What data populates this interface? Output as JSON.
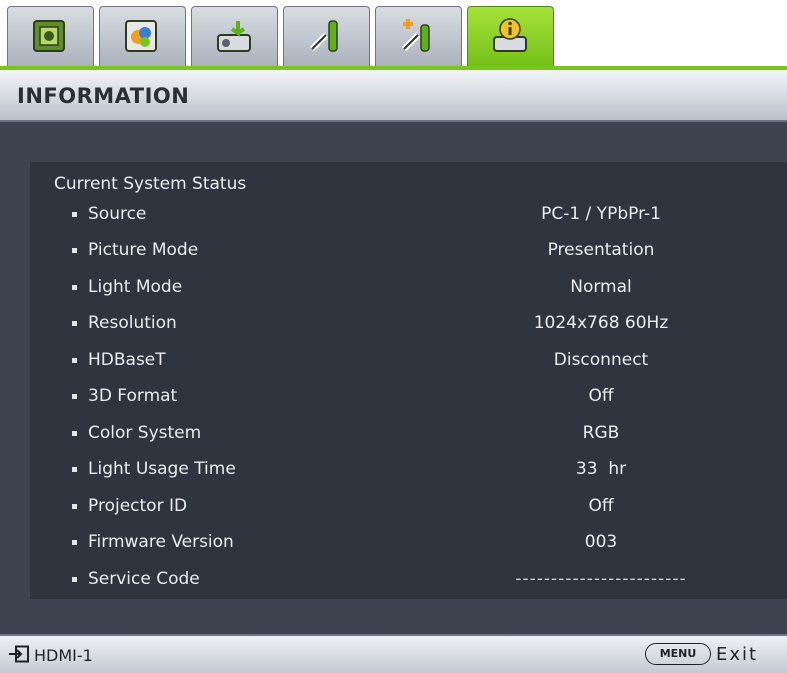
{
  "tabs": [
    {
      "icon": "display-picture-icon",
      "active": false
    },
    {
      "icon": "picture-adjust-icon",
      "active": false
    },
    {
      "icon": "projector-source-icon",
      "active": false
    },
    {
      "icon": "system-setup-basic-icon",
      "active": false
    },
    {
      "icon": "system-setup-advanced-icon",
      "active": false
    },
    {
      "icon": "information-icon",
      "active": true
    }
  ],
  "header": {
    "title": "INFORMATION"
  },
  "status": {
    "heading": "Current System Status",
    "items": [
      {
        "label": "Source",
        "value": "PC-1 / YPbPr-1"
      },
      {
        "label": "Picture Mode",
        "value": "Presentation"
      },
      {
        "label": "Light Mode",
        "value": "Normal"
      },
      {
        "label": "Resolution",
        "value": "1024x768 60Hz"
      },
      {
        "label": "HDBaseT",
        "value": "Disconnect"
      },
      {
        "label": "3D Format",
        "value": "Off"
      },
      {
        "label": "Color System",
        "value": "RGB"
      },
      {
        "label": "Light Usage Time",
        "value": "33  hr"
      },
      {
        "label": "Projector ID",
        "value": "Off"
      },
      {
        "label": "Firmware Version",
        "value": "003"
      },
      {
        "label": "Service Code",
        "value": "------------------------"
      }
    ]
  },
  "footer": {
    "source_icon": "input-source-icon",
    "source": "HDMI-1",
    "menu_label": "MENU",
    "exit_label": "Exit"
  },
  "colors": {
    "accent_green": "#7ac41c",
    "panel_bg": "#2f353f",
    "main_bg": "#3d4450"
  }
}
